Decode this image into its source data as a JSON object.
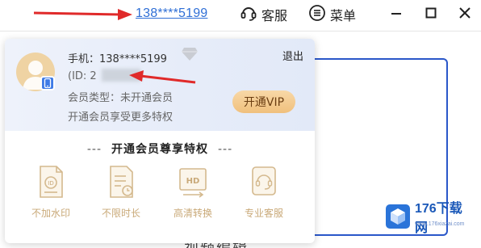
{
  "header": {
    "phone": "138****5199",
    "service_label": "客服",
    "menu_label": "菜单"
  },
  "popup": {
    "phone_line": "手机：138****5199",
    "id_prefix": "(ID: 2",
    "member_type": "会员类型：未开通会员",
    "member_hint": "开通会员享受更多特权",
    "logout_label": "退出",
    "vip_button_label": "开通VIP",
    "privileges_title": "开通会员尊享特权",
    "privileges_dash_left": "---",
    "privileges_dash_right": "---",
    "features": [
      {
        "label": "不加水印",
        "icon": "no-watermark-icon"
      },
      {
        "label": "不限时长",
        "icon": "unlimited-duration-icon"
      },
      {
        "label": "高清转换",
        "icon": "hd-conversion-icon"
      },
      {
        "label": "专业客服",
        "icon": "pro-support-icon"
      }
    ]
  },
  "background": {
    "bottom_text": "视频编辑"
  },
  "watermark": {
    "brand": "176下载网",
    "domain": "www.176xiazai.com"
  },
  "colors": {
    "link": "#2f6fd6",
    "vip_gold": "#f0c07d",
    "feature_gold": "#c9a978",
    "annotation_red": "#e02a2a"
  }
}
